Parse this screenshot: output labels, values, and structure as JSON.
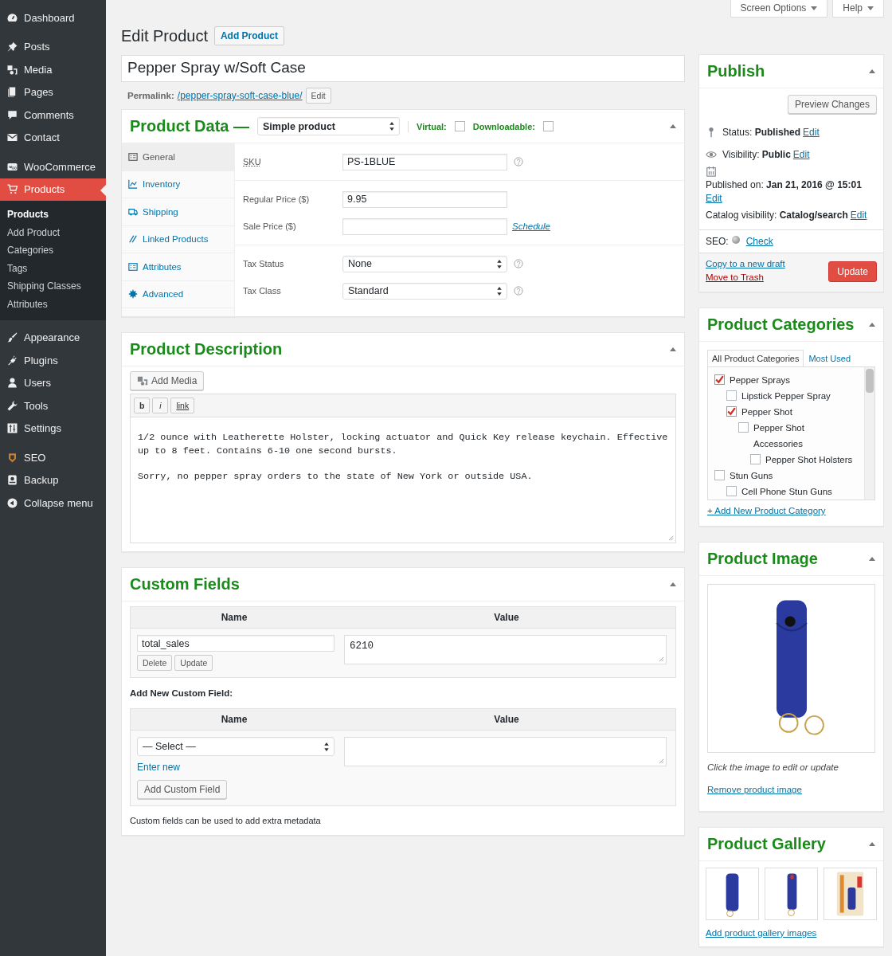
{
  "sidebar": {
    "groups": [
      {
        "items": [
          {
            "label": "Dashboard",
            "selected": false
          }
        ]
      },
      {
        "items": [
          {
            "label": "Posts",
            "selected": false
          },
          {
            "label": "Media",
            "selected": false
          },
          {
            "label": "Pages",
            "selected": false
          },
          {
            "label": "Comments",
            "selected": false
          },
          {
            "label": "Contact",
            "selected": false
          }
        ]
      },
      {
        "items": [
          {
            "label": "WooCommerce",
            "selected": false
          },
          {
            "label": "Products",
            "selected": true,
            "children": [
              {
                "label": "Products",
                "selected": true
              },
              {
                "label": "Add Product",
                "selected": false
              },
              {
                "label": "Categories",
                "selected": false
              },
              {
                "label": "Tags",
                "selected": false
              },
              {
                "label": "Shipping Classes",
                "selected": false
              },
              {
                "label": "Attributes",
                "selected": false
              }
            ]
          }
        ]
      },
      {
        "items": [
          {
            "label": "Appearance",
            "selected": false
          },
          {
            "label": "Plugins",
            "selected": false
          },
          {
            "label": "Users",
            "selected": false
          },
          {
            "label": "Tools",
            "selected": false
          },
          {
            "label": "Settings",
            "selected": false
          }
        ]
      },
      {
        "items": [
          {
            "label": "SEO",
            "selected": false
          },
          {
            "label": "Backup",
            "selected": false
          },
          {
            "label": "Collapse menu",
            "selected": false
          }
        ]
      }
    ]
  },
  "top_buttons": [
    "Screen Options",
    "Help"
  ],
  "header": {
    "title": "Edit Product",
    "add_button": "Add Product"
  },
  "post_title": {
    "value": "Pepper Spray w/Soft Case"
  },
  "permalink": {
    "label": "Permalink:",
    "url": "/pepper-spray-soft-case-blue/",
    "edit": "Edit"
  },
  "product_data": {
    "title": "Product Data —",
    "type": "Simple product",
    "options": [
      {
        "label": "Virtual:",
        "checked": false
      },
      {
        "label": "Downloadable:",
        "checked": false
      }
    ],
    "tabs": [
      {
        "label": "General",
        "selected": true
      },
      {
        "label": "Inventory",
        "selected": false
      },
      {
        "label": "Shipping",
        "selected": false
      },
      {
        "label": "Linked Products",
        "selected": false
      },
      {
        "label": "Attributes",
        "selected": false
      },
      {
        "label": "Advanced",
        "selected": false
      }
    ],
    "groups": [
      {
        "fields": [
          {
            "label": "SKU",
            "kind": "input",
            "value": "PS-1BLUE",
            "help": true
          }
        ]
      },
      {
        "fields": [
          {
            "label": "Regular Price ($)",
            "kind": "input",
            "value": "9.95",
            "help": false
          },
          {
            "label": "Sale Price ($)",
            "kind": "input",
            "help": false,
            "link": "Schedule"
          }
        ]
      },
      {
        "fields": [
          {
            "label": "Tax Status",
            "kind": "select",
            "value": "None",
            "help": true
          },
          {
            "label": "Tax Class",
            "kind": "select",
            "value": "Standard",
            "help": true
          }
        ]
      }
    ]
  },
  "description": {
    "title": "Product Description",
    "add_media": "Add Media",
    "toolbar": [
      "b",
      "i",
      "link"
    ],
    "paragraphs": [
      "1/2 ounce with Leatherette Holster, locking actuator and Quick Key release keychain. Effective up to 8 feet. Contains 6-10 one second bursts.",
      "Sorry, no pepper spray orders to the state of New York or outside USA."
    ]
  },
  "custom_fields": {
    "title": "Custom Fields",
    "columns": [
      "Name",
      "Value"
    ],
    "rows": [
      {
        "name": "total_sales",
        "value": "6210",
        "buttons": [
          "Delete",
          "Update"
        ]
      }
    ],
    "add_label": "Add New Custom Field:",
    "new_columns": [
      "Name",
      "Value"
    ],
    "select": "— Select —",
    "enter_new": "Enter new",
    "add_button": "Add Custom Field",
    "note": "Custom fields can be used to add extra metadata"
  },
  "publish": {
    "title": "Publish",
    "preview": "Preview Changes",
    "rows": [
      {
        "label": "Status:",
        "value": "Published",
        "link": "Edit"
      },
      {
        "label": "Visibility:",
        "value": "Public",
        "link": "Edit"
      },
      {
        "label": "Published on:",
        "value": "Jan 21, 2016 @ 15:01",
        "link": "Edit"
      },
      {
        "label": "Catalog visibility:",
        "value": "Catalog/search",
        "link": "Edit"
      }
    ],
    "seo": {
      "label": "SEO:",
      "link": "Check"
    },
    "copy_link": "Copy to a new draft",
    "trash_link": "Move to Trash",
    "update": "Update"
  },
  "categories": {
    "title": "Product Categories",
    "tabs": [
      {
        "label": "All Product Categories",
        "selected": true
      },
      {
        "label": "Most Used",
        "selected": false
      }
    ],
    "items": [
      {
        "label": "Pepper Sprays",
        "checked": true,
        "children": [
          {
            "label": "Lipstick Pepper Spray",
            "checked": false
          },
          {
            "label": "Pepper Shot",
            "checked": true,
            "children": [
              {
                "label": "Pepper Shot Accessories",
                "checked": false,
                "children": [
                  {
                    "label": "Pepper Shot Holsters",
                    "checked": false
                  }
                ]
              }
            ]
          }
        ]
      },
      {
        "label": "Stun Guns",
        "checked": false,
        "children": [
          {
            "label": "Cell Phone Stun Guns",
            "checked": false
          }
        ]
      }
    ],
    "add_link": "+ Add New Product Category"
  },
  "product_image": {
    "title": "Product Image",
    "caption": "Click the image to edit or update",
    "remove_link": "Remove product image"
  },
  "gallery": {
    "title": "Product Gallery",
    "add_link": "Add product gallery images"
  }
}
